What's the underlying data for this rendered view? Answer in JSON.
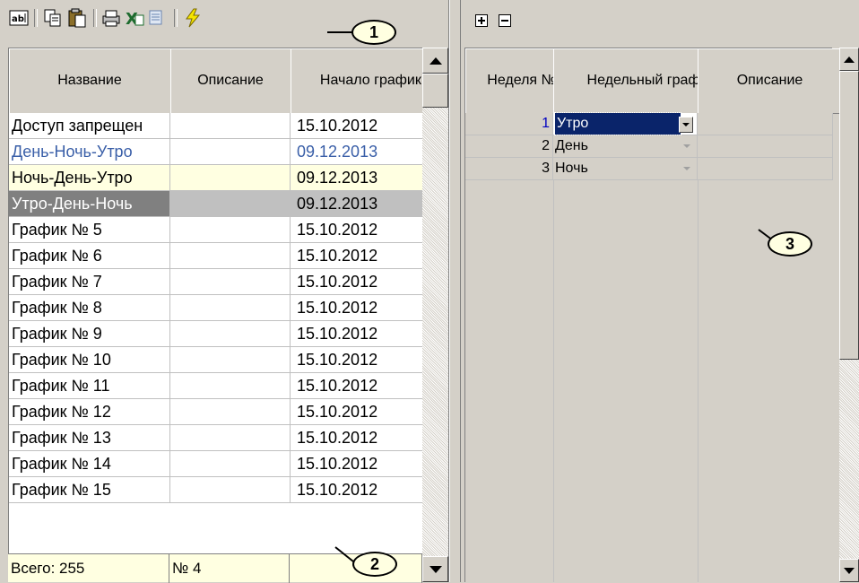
{
  "left": {
    "toolbar": {
      "icons": [
        "edit-name-icon",
        "copy-icon",
        "paste-icon",
        "print-icon",
        "export-excel-icon",
        "export-icon",
        "apply-lightning-icon"
      ]
    },
    "columns": [
      "Название",
      "Описание",
      "Начало графика"
    ],
    "rows": [
      {
        "name": "Доступ запрещен",
        "description": "",
        "start": "15.10.2012",
        "style": "normal"
      },
      {
        "name": "День-Ночь-Утро",
        "description": "",
        "start": "09.12.2013",
        "style": "blue"
      },
      {
        "name": "Ночь-День-Утро",
        "description": "",
        "start": "09.12.2013",
        "style": "yellow"
      },
      {
        "name": "Утро-День-Ночь",
        "description": "",
        "start": "09.12.2013",
        "style": "selected"
      },
      {
        "name": "График №   5",
        "description": "",
        "start": "15.10.2012",
        "style": "normal"
      },
      {
        "name": "График №   6",
        "description": "",
        "start": "15.10.2012",
        "style": "normal"
      },
      {
        "name": "График №   7",
        "description": "",
        "start": "15.10.2012",
        "style": "normal"
      },
      {
        "name": "График №   8",
        "description": "",
        "start": "15.10.2012",
        "style": "normal"
      },
      {
        "name": "График №   9",
        "description": "",
        "start": "15.10.2012",
        "style": "normal"
      },
      {
        "name": "График №  10",
        "description": "",
        "start": "15.10.2012",
        "style": "normal"
      },
      {
        "name": "График №  11",
        "description": "",
        "start": "15.10.2012",
        "style": "normal"
      },
      {
        "name": "График №  12",
        "description": "",
        "start": "15.10.2012",
        "style": "normal"
      },
      {
        "name": "График №  13",
        "description": "",
        "start": "15.10.2012",
        "style": "normal"
      },
      {
        "name": "График №  14",
        "description": "",
        "start": "15.10.2012",
        "style": "normal"
      },
      {
        "name": "График №  15",
        "description": "",
        "start": "15.10.2012",
        "style": "normal"
      }
    ],
    "footer": {
      "total": "Всего: 255",
      "current": "№ 4",
      "empty": ""
    }
  },
  "right": {
    "toolbar": {
      "icons": [
        "add-row-icon",
        "remove-row-icon"
      ]
    },
    "columns": [
      "Неделя №",
      "Недельный график",
      "Описание"
    ],
    "rows": [
      {
        "week": "1",
        "schedule": "Утро",
        "description": "",
        "active": true
      },
      {
        "week": "2",
        "schedule": "День",
        "description": "",
        "active": false
      },
      {
        "week": "3",
        "schedule": "Ночь",
        "description": "",
        "active": false
      }
    ]
  },
  "callouts": [
    "1",
    "2",
    "3"
  ],
  "colors": {
    "selected_bg": "#c0c0c0",
    "yellow_bg": "#ffffe1",
    "blue_text": "#3a5fa8",
    "active_cell_bg": "#0a246a"
  }
}
